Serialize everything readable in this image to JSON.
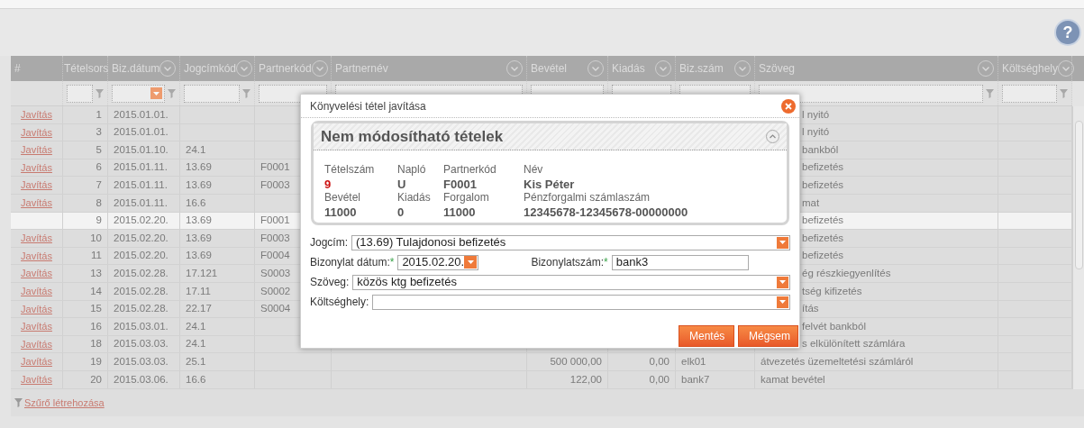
{
  "help": {
    "icon_text": "?"
  },
  "table": {
    "columns": [
      {
        "label": "#",
        "menu": false,
        "kind": "none",
        "filter_icon": false
      },
      {
        "label": "Tételsors",
        "menu": false,
        "kind": "text",
        "filter_icon": true
      },
      {
        "label": "Biz.dátum",
        "menu": true,
        "kind": "date",
        "filter_icon": true
      },
      {
        "label": "Jogcímkód",
        "menu": true,
        "kind": "text",
        "filter_icon": true
      },
      {
        "label": "Partnerkód",
        "menu": true,
        "kind": "text",
        "filter_icon": false
      },
      {
        "label": "Partnernév",
        "menu": true,
        "kind": "text",
        "filter_icon": false
      },
      {
        "label": "Bevétel",
        "menu": true,
        "kind": "text",
        "filter_icon": false
      },
      {
        "label": "Kiadás",
        "menu": true,
        "kind": "text",
        "filter_icon": false
      },
      {
        "label": "Biz.szám",
        "menu": true,
        "kind": "text",
        "filter_icon": false
      },
      {
        "label": "Szöveg",
        "menu": true,
        "kind": "text",
        "filter_icon": true
      },
      {
        "label": "Költséghely",
        "menu": true,
        "kind": "text",
        "filter_icon": true
      }
    ],
    "rows": [
      {
        "action": "Javítás",
        "selected": false,
        "kind": "covered",
        "tetel": "1",
        "datum": "2015.01.01.",
        "szoveg": "l nyitó"
      },
      {
        "action": "Javítás",
        "selected": false,
        "kind": "covered",
        "tetel": "3",
        "datum": "2015.01.01.",
        "szoveg": "l nyitó"
      },
      {
        "action": "Javítás",
        "selected": false,
        "kind": "covered",
        "tetel": "5",
        "datum": "2015.01.10.",
        "jogcim": "24.1",
        "szoveg": "bankból"
      },
      {
        "action": "Javítás",
        "selected": false,
        "kind": "covered",
        "tetel": "6",
        "datum": "2015.01.11.",
        "jogcim": "13.69",
        "partnerkod": "F0001",
        "szoveg": "befizetés"
      },
      {
        "action": "Javítás",
        "selected": false,
        "kind": "covered",
        "tetel": "7",
        "datum": "2015.01.11.",
        "jogcim": "13.69",
        "partnerkod": "F0003",
        "szoveg": "befizetés"
      },
      {
        "action": "Javítás",
        "selected": false,
        "kind": "covered",
        "tetel": "8",
        "datum": "2015.01.11.",
        "jogcim": "16.6",
        "szoveg": "mat"
      },
      {
        "selected": true,
        "kind": "covered",
        "tetel": "9",
        "datum": "2015.02.20.",
        "jogcim": "13.69",
        "partnerkod": "F0001",
        "szoveg": "befizetés"
      },
      {
        "action": "Javítás",
        "selected": false,
        "kind": "covered",
        "tetel": "10",
        "datum": "2015.02.20.",
        "jogcim": "13.69",
        "partnerkod": "F0003",
        "szoveg": "befizetés"
      },
      {
        "action": "Javítás",
        "selected": false,
        "kind": "covered",
        "tetel": "11",
        "datum": "2015.02.20.",
        "jogcim": "13.69",
        "partnerkod": "F0004",
        "szoveg": "befizetés"
      },
      {
        "action": "Javítás",
        "selected": false,
        "kind": "covered",
        "tetel": "13",
        "datum": "2015.02.28.",
        "jogcim": "17.121",
        "partnerkod": "S0003",
        "szoveg": "ég részkiegyenlítés"
      },
      {
        "action": "Javítás",
        "selected": false,
        "kind": "covered",
        "tetel": "14",
        "datum": "2015.02.28.",
        "jogcim": "17.11",
        "partnerkod": "S0002",
        "szoveg": "tség kifizetés"
      },
      {
        "action": "Javítás",
        "selected": false,
        "kind": "covered",
        "tetel": "15",
        "datum": "2015.02.28.",
        "jogcim": "22.17",
        "partnerkod": "S0004",
        "szoveg": "ítás"
      },
      {
        "action": "Javítás",
        "selected": false,
        "kind": "covered",
        "tetel": "16",
        "datum": "2015.03.01.",
        "jogcim": "24.1",
        "szoveg": "felvét bankból"
      },
      {
        "action": "Javítás",
        "selected": false,
        "kind": "covered",
        "tetel": "18",
        "datum": "2015.03.03.",
        "jogcim": "24.1",
        "szoveg": "s elkülönített számlára"
      },
      {
        "action": "Javítás",
        "selected": false,
        "kind": "full",
        "tetel": "19",
        "datum": "2015.03.03.",
        "jogcim": "25.1",
        "bevetel": "500 000,00",
        "kiadas": "0,00",
        "bizszam": "elk01",
        "szoveg": "átvezetés üzemeltetési számláról"
      },
      {
        "action": "Javítás",
        "selected": false,
        "kind": "full",
        "tetel": "20",
        "datum": "2015.03.06.",
        "jogcim": "16.6",
        "bevetel": "122,00",
        "kiadas": "0,00",
        "bizszam": "bank7",
        "szoveg": "kamat bevétel"
      }
    ],
    "footer_link": "Szűrő létrehozása"
  },
  "dialog": {
    "title": "Könyvelési tétel javítása",
    "panel": {
      "title": "Nem módosítható tételek",
      "expanded": true,
      "fields": [
        {
          "label": "Tételszám",
          "value": "9",
          "kind": "key"
        },
        {
          "label": "Napló",
          "value": "U",
          "kind": "plain"
        },
        {
          "label": "Partnerkód",
          "value": "F0001",
          "kind": "plain"
        },
        {
          "label": "Név",
          "value": "Kis Péter",
          "kind": "plain"
        },
        {
          "label": "Bevétel",
          "value": "11000",
          "kind": "plain"
        },
        {
          "label": "Kiadás",
          "value": "0",
          "kind": "plain"
        },
        {
          "label": "Forgalom",
          "value": "11000",
          "kind": "plain"
        },
        {
          "label": "Pénzforgalmi számlaszám",
          "value": "12345678-12345678-00000000",
          "kind": "plain"
        }
      ]
    },
    "form": {
      "jogcim": {
        "label": "Jogcím:",
        "value": "(13.69) Tulajdonosi befizetés"
      },
      "datum": {
        "label": "Bizonylat dátum:",
        "required_mark": "*",
        "value": "2015.02.20."
      },
      "bizonylatszam": {
        "label": "Bizonylatszám:",
        "required_mark": "*",
        "value": "bank3"
      },
      "szoveg": {
        "label": "Szöveg:",
        "value": "közös ktg befizetés"
      },
      "koltseghely": {
        "label": "Költséghely:"
      }
    },
    "buttons": [
      "Mentés",
      "Mégsem"
    ]
  }
}
